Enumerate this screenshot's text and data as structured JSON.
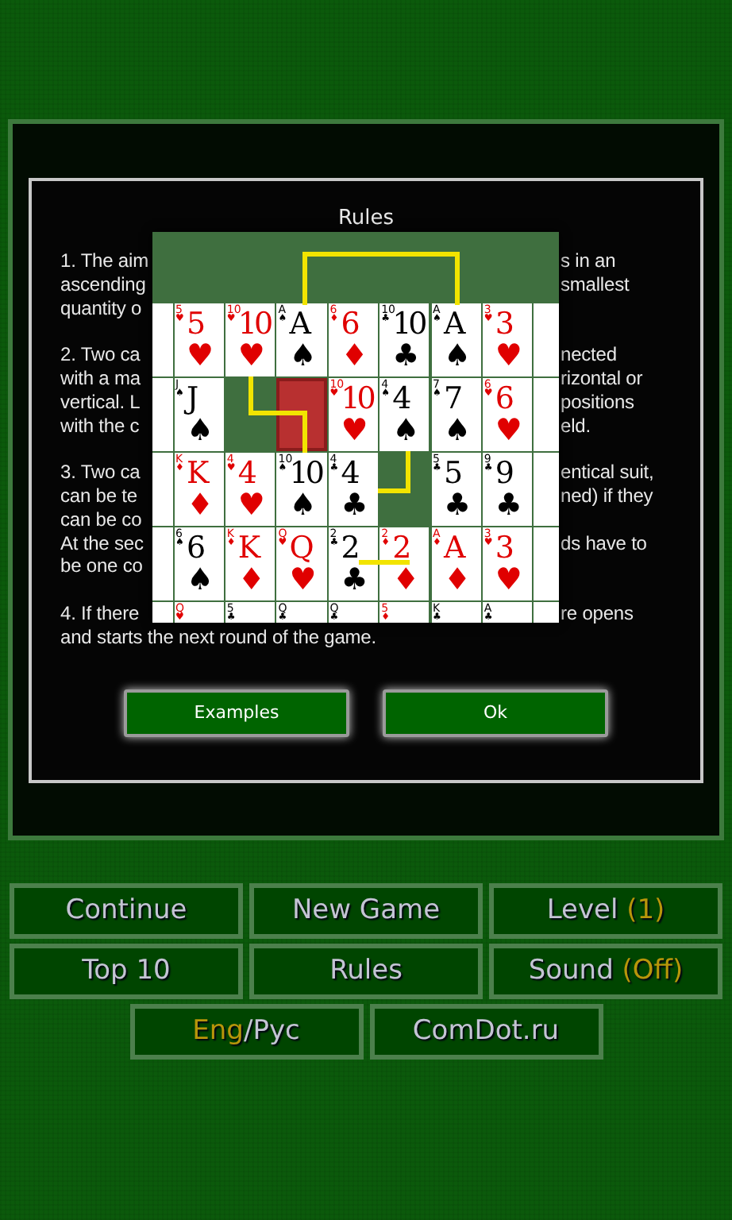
{
  "dialog": {
    "title": "Rules",
    "paragraphs": [
      [
        {
          "left": "1. The aim",
          "right": "s in an"
        },
        {
          "left": "ascending",
          "right": "smallest"
        },
        {
          "left": "quantity o"
        }
      ],
      [
        {
          "left": "2. Two ca",
          "right": "nected"
        },
        {
          "left": "with a ma",
          "right": "rizontal or"
        },
        {
          "left": "vertical. L",
          "right": "positions"
        },
        {
          "left": "with the c",
          "right": "eld."
        }
      ],
      [
        {
          "left": "3. Two ca",
          "right": "entical suit,"
        },
        {
          "left": "can be te",
          "right": "ned) if they"
        },
        {
          "left": "can be co"
        },
        {
          "left": "At the sec",
          "right": "ds have to"
        },
        {
          "left": "be one co"
        }
      ],
      [
        {
          "left": "4. If there",
          "right": "re opens"
        },
        {
          "left": "and starts the next round of the game."
        }
      ]
    ],
    "example_rows": [
      [
        {
          "kind": "card",
          "corner_rank": "5",
          "corner_suit": "♥",
          "rank": "5",
          "suit": "♥",
          "color": "#e00000"
        },
        {
          "kind": "card",
          "corner_rank": "10",
          "corner_suit": "♥",
          "rank": "10",
          "suit": "♥",
          "color": "#e00000"
        },
        {
          "kind": "card",
          "corner_rank": "A",
          "corner_suit": "♠",
          "rank": "A",
          "suit": "♠",
          "color": "#000000"
        },
        {
          "kind": "card",
          "corner_rank": "6",
          "corner_suit": "♦",
          "rank": "6",
          "suit": "♦",
          "color": "#e00000"
        },
        {
          "kind": "card",
          "corner_rank": "10",
          "corner_suit": "♣",
          "rank": "10",
          "suit": "♣",
          "color": "#000000"
        },
        {
          "kind": "card",
          "corner_rank": "A",
          "corner_suit": "♠",
          "rank": "A",
          "suit": "♠",
          "color": "#000000"
        },
        {
          "kind": "card",
          "corner_rank": "3",
          "corner_suit": "♥",
          "rank": "3",
          "suit": "♥",
          "color": "#e00000"
        }
      ],
      [
        {
          "kind": "card",
          "corner_rank": "J",
          "corner_suit": "♠",
          "rank": "J",
          "suit": "♠",
          "color": "#000000"
        },
        {
          "kind": "empty"
        },
        {
          "kind": "back",
          "selected": true
        },
        {
          "kind": "card",
          "corner_rank": "10",
          "corner_suit": "♥",
          "rank": "10",
          "suit": "♥",
          "color": "#e00000"
        },
        {
          "kind": "card",
          "corner_rank": "4",
          "corner_suit": "♠",
          "rank": "4",
          "suit": "♠",
          "color": "#000000"
        },
        {
          "kind": "card",
          "corner_rank": "7",
          "corner_suit": "♠",
          "rank": "7",
          "suit": "♠",
          "color": "#000000"
        },
        {
          "kind": "card",
          "corner_rank": "6",
          "corner_suit": "♥",
          "rank": "6",
          "suit": "♥",
          "color": "#e00000"
        }
      ],
      [
        {
          "kind": "card",
          "corner_rank": "K",
          "corner_suit": "♦",
          "rank": "K",
          "suit": "♦",
          "color": "#e00000"
        },
        {
          "kind": "card",
          "corner_rank": "4",
          "corner_suit": "♥",
          "rank": "4",
          "suit": "♥",
          "color": "#e00000"
        },
        {
          "kind": "card",
          "corner_rank": "10",
          "corner_suit": "♠",
          "rank": "10",
          "suit": "♠",
          "color": "#000000"
        },
        {
          "kind": "card",
          "corner_rank": "4",
          "corner_suit": "♣",
          "rank": "4",
          "suit": "♣",
          "color": "#000000"
        },
        {
          "kind": "empty"
        },
        {
          "kind": "card",
          "corner_rank": "5",
          "corner_suit": "♣",
          "rank": "5",
          "suit": "♣",
          "color": "#000000"
        },
        {
          "kind": "card",
          "corner_rank": "9",
          "corner_suit": "♣",
          "rank": "9",
          "suit": "♣",
          "color": "#000000"
        }
      ],
      [
        {
          "kind": "card",
          "corner_rank": "6",
          "corner_suit": "♠",
          "rank": "6",
          "suit": "♠",
          "color": "#000000"
        },
        {
          "kind": "card",
          "corner_rank": "K",
          "corner_suit": "♦",
          "rank": "K",
          "suit": "♦",
          "color": "#e00000"
        },
        {
          "kind": "card",
          "corner_rank": "Q",
          "corner_suit": "♥",
          "rank": "Q",
          "suit": "♥",
          "color": "#e00000"
        },
        {
          "kind": "card",
          "corner_rank": "2",
          "corner_suit": "♣",
          "rank": "2",
          "suit": "♣",
          "color": "#000000"
        },
        {
          "kind": "card",
          "corner_rank": "2",
          "corner_suit": "♦",
          "rank": "2",
          "suit": "♦",
          "color": "#e00000"
        },
        {
          "kind": "card",
          "corner_rank": "A",
          "corner_suit": "♦",
          "rank": "A",
          "suit": "♦",
          "color": "#e00000"
        },
        {
          "kind": "card",
          "corner_rank": "3",
          "corner_suit": "♥",
          "rank": "3",
          "suit": "♥",
          "color": "#e00000"
        }
      ],
      [
        {
          "kind": "card",
          "corner_rank": "Q",
          "corner_suit": "♥",
          "color": "#e00000"
        },
        {
          "kind": "card",
          "corner_rank": "5",
          "corner_suit": "♣",
          "color": "#000000"
        },
        {
          "kind": "card",
          "corner_rank": "Q",
          "corner_suit": "♣",
          "color": "#000000"
        },
        {
          "kind": "card",
          "corner_rank": "Q",
          "corner_suit": "♣",
          "color": "#000000"
        },
        {
          "kind": "card",
          "corner_rank": "5",
          "corner_suit": "♦",
          "color": "#e00000"
        },
        {
          "kind": "card",
          "corner_rank": "K",
          "corner_suit": "♣",
          "color": "#000000"
        },
        {
          "kind": "card",
          "corner_rank": "A",
          "corner_suit": "♣",
          "color": "#000000"
        }
      ]
    ],
    "buttons": [
      "Examples",
      "Ok"
    ]
  },
  "menu_rows": [
    [
      {
        "label": "Continue"
      },
      {
        "label": "New Game"
      },
      {
        "label": "Level",
        "value": "(1)"
      }
    ],
    [
      {
        "label": "Top 10"
      },
      {
        "label": "Rules"
      },
      {
        "label": "Sound",
        "value": "(Off)"
      }
    ],
    [
      {
        "kind": "language",
        "languages": [
          {
            "label": "Eng",
            "selected": true
          },
          {
            "label": "Рус",
            "selected": false
          }
        ],
        "separator": "/"
      },
      {
        "label": "ComDot.ru"
      }
    ]
  ]
}
